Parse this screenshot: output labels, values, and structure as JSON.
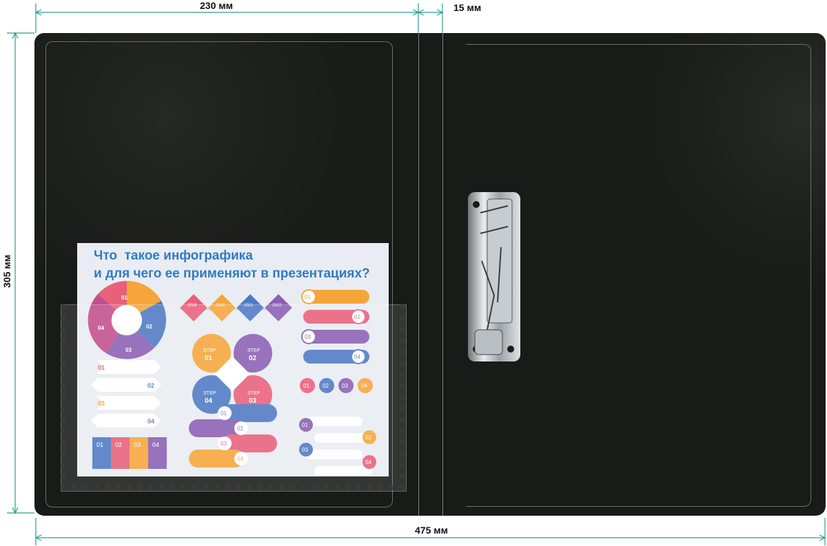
{
  "dimensions": {
    "width_top": "230 мм",
    "spine": "15 мм",
    "height": "305 мм",
    "total_width": "475 мм"
  },
  "sheet": {
    "title": "Что  такое инфографика\nи для чего ее применяют в презентациях?",
    "timeline_years": [
      "2019",
      "2020",
      "2021",
      "2022"
    ],
    "steps": [
      "STEP\n01",
      "STEP\n02",
      "STEP\n04",
      "STEP\n03"
    ],
    "numbers": [
      "01",
      "02",
      "03",
      "04"
    ]
  },
  "colors": {
    "folder": "#181b18",
    "title": "#2f7bc3",
    "pink": "#e8607a",
    "orange": "#f5a53a",
    "blue": "#4f79c4",
    "purple": "#8a5fb3"
  }
}
